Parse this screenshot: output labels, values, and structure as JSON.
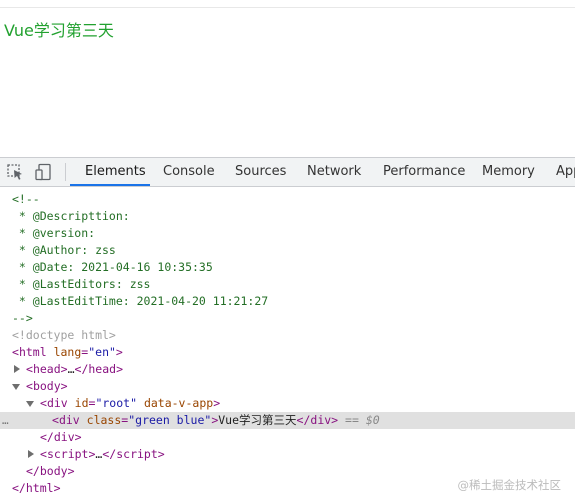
{
  "page": {
    "text": "Vue学习第三天"
  },
  "devtools": {
    "tabs": [
      {
        "label": "Elements",
        "active": true
      },
      {
        "label": "Console"
      },
      {
        "label": "Sources"
      },
      {
        "label": "Network"
      },
      {
        "label": "Performance"
      },
      {
        "label": "Memory"
      },
      {
        "label": "App"
      }
    ],
    "comment": [
      "<!--",
      " * @Descripttion:",
      " * @version:",
      " * @Author: zss",
      " * @Date: 2021-04-16 10:35:35",
      " * @LastEditors: zss",
      " * @LastEditTime: 2021-04-20 11:21:27",
      "-->"
    ],
    "doctype": "<!doctype html>",
    "html_tag": "html",
    "html_attr": "lang",
    "html_attr_val": "\"en\"",
    "head_tag": "head",
    "body_tag": "body",
    "div_tag": "div",
    "div_id_attr": "id",
    "div_id_val": "\"root\"",
    "div_extra_attr": "data-v-app",
    "inner_div_class_attr": "class",
    "inner_div_class_val": "\"green blue\"",
    "inner_text": "Vue学习第三天",
    "selected_suffix": "== $0",
    "script_tag": "script",
    "ellipsis": "…",
    "row_menu": "…"
  },
  "watermark": "@稀土掘金技术社区",
  "colors": {
    "page_text": "#22a12f",
    "tab_active_underline": "#1a73e8",
    "selected_row": "#e0e0e0"
  },
  "icons": [
    "inspect-element-icon",
    "device-toolbar-icon"
  ]
}
